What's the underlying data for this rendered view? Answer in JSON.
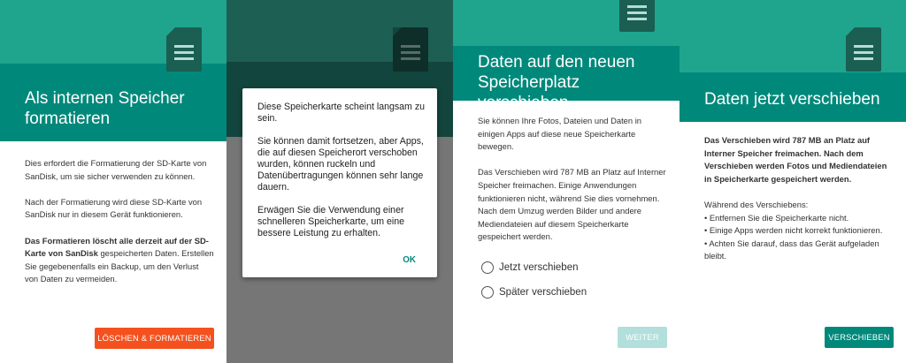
{
  "screen1": {
    "title": "Als internen Speicher formatieren",
    "paragraphs": [
      "Dies erfordert die Formatierung der SD-Karte von SanDisk, um sie sicher verwenden zu können.",
      "Nach der Formatierung wird diese SD-Karte von SanDisk nur in diesem Gerät funktionieren."
    ],
    "warning_bold": "Das Formatieren löscht alle derzeit auf der SD-Karte von SanDisk",
    "warning_rest": " gespeicherten Daten. Erstellen Sie gegebenenfalls ein Backup, um den Verlust von Daten zu vermeiden.",
    "button": "LÖSCHEN & FORMATIEREN"
  },
  "screen2": {
    "dialog": {
      "paragraphs": [
        "Diese Speicherkarte scheint langsam zu sein.",
        "Sie können damit fortsetzen, aber Apps, die auf diesen Speicherort verschoben wurden, können ruckeln und Datenübertragungen können sehr lange dauern.",
        "Erwägen Sie die Verwendung einer schnelleren Speicherkarte, um eine bessere Leistung zu erhalten."
      ],
      "ok": "OK"
    }
  },
  "screen3": {
    "title": "Daten auf den neuen Speicherplatz verschieben",
    "paragraphs": [
      "Sie können Ihre Fotos, Dateien und Daten in einigen Apps auf diese neue Speicherkarte bewegen.",
      "Das Verschieben wird 787 MB an Platz auf Interner Speicher freimachen. Einige Anwendungen funktionieren nicht, während Sie dies vornehmen. Nach dem Umzug werden Bilder und andere Mediendateien auf diesem Speicherkarte gespeichert werden."
    ],
    "options": [
      "Jetzt verschieben",
      "Später verschieben"
    ],
    "button": "WEITER"
  },
  "screen4": {
    "title": "Daten jetzt verschieben",
    "bold_text": "Das Verschieben wird 787 MB an Platz auf Interner Speicher freimachen. Nach dem Verschieben werden Fotos und Mediendateien in Speicherkarte gespeichert werden.",
    "during_heading": "Während des Verschiebens:",
    "bullets": [
      "• Entfernen Sie die Speicherkarte nicht.",
      "• Einige Apps werden nicht korrekt funktionieren.",
      "• Achten Sie darauf, dass das Gerät aufgeladen bleibt."
    ],
    "button": "VERSCHIEBEN"
  },
  "colors": {
    "header_light": "#1fa58d",
    "header_dark": "#00897b",
    "danger": "#f4511e",
    "disabled": "#b2dfdb"
  },
  "icons": [
    "sd-card-icon"
  ]
}
